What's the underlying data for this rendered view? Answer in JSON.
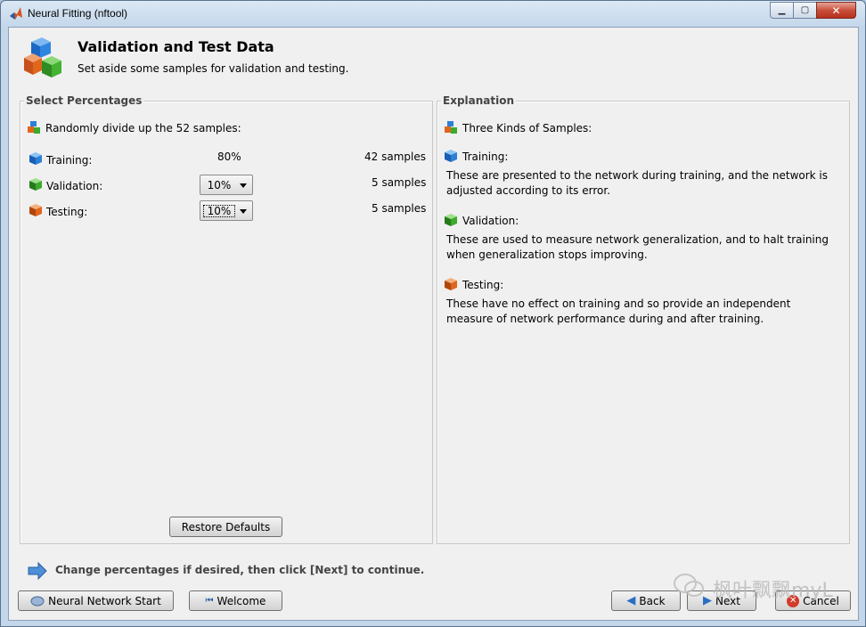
{
  "window": {
    "title": "Neural Fitting (nftool)"
  },
  "header": {
    "title": "Validation and Test Data",
    "subtitle": "Set aside some samples for validation and testing."
  },
  "left_panel": {
    "title": "Select Percentages",
    "intro": "Randomly divide up the 52 samples:",
    "rows": [
      {
        "label": "Training:",
        "percent": "80%",
        "samples": "42 samples",
        "color": "#2d7fd6"
      },
      {
        "label": "Validation:",
        "percent": "10%",
        "samples": "5 samples",
        "color": "#3caa2c"
      },
      {
        "label": "Testing:",
        "percent": "10%",
        "samples": "5 samples",
        "color": "#e0661c"
      }
    ],
    "restore_label": "Restore Defaults"
  },
  "right_panel": {
    "title": "Explanation",
    "intro": "Three Kinds of Samples:",
    "sections": [
      {
        "heading": "Training:",
        "text": "These are presented to the network during training, and the network is adjusted according to its error."
      },
      {
        "heading": "Validation:",
        "text": "These are used to measure network generalization, and to halt training when generalization stops improving."
      },
      {
        "heading": "Testing:",
        "text": "These have no effect on training and so provide an independent measure of network performance during and after training."
      }
    ]
  },
  "hint": "Change percentages if desired, then click [Next] to continue.",
  "buttons": {
    "nn_start": "Neural Network Start",
    "welcome": "Welcome",
    "back": "Back",
    "next": "Next",
    "cancel": "Cancel"
  },
  "watermark": "枫叶飘飘myL"
}
